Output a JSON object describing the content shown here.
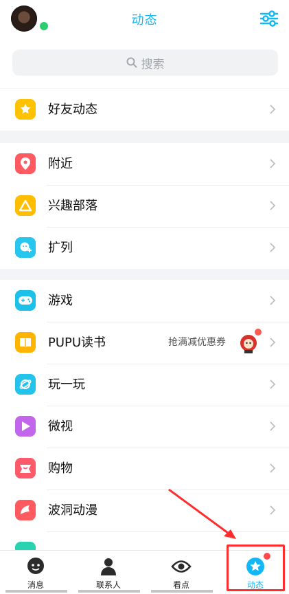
{
  "header": {
    "title": "动态",
    "settings_icon": "sliders-icon",
    "avatar_status_color": "#2ecc71"
  },
  "search": {
    "placeholder": "搜索"
  },
  "sections": [
    {
      "items": [
        {
          "label": "好友动态",
          "icon": "star-speech-icon",
          "color": "#ffc200"
        }
      ]
    },
    {
      "items": [
        {
          "label": "附近",
          "icon": "location-pin-icon",
          "color": "#ff5a5f"
        },
        {
          "label": "兴趣部落",
          "icon": "tent-icon",
          "color": "#ffbd00"
        },
        {
          "label": "扩列",
          "icon": "add-friend-icon",
          "color": "#27c6ee"
        }
      ]
    },
    {
      "items": [
        {
          "label": "游戏",
          "icon": "gamepad-icon",
          "color": "#1cc1ea"
        },
        {
          "label": "PUPU读书",
          "icon": "book-icon",
          "color": "#ffb400",
          "promo": "抢满减优惠券"
        },
        {
          "label": "玩一玩",
          "icon": "planet-icon",
          "color": "#23c3eb"
        },
        {
          "label": "微视",
          "icon": "play-icon",
          "color": "#c267ec"
        },
        {
          "label": "购物",
          "icon": "shopping-icon",
          "color": "#ff5a6a"
        },
        {
          "label": "波洞动漫",
          "icon": "comic-icon",
          "color": "#ff5a5f"
        }
      ]
    }
  ],
  "tabs": [
    {
      "label": "消息",
      "icon": "message-bubble-icon"
    },
    {
      "label": "联系人",
      "icon": "contacts-icon"
    },
    {
      "label": "看点",
      "icon": "eye-icon"
    },
    {
      "label": "动态",
      "icon": "star-icon",
      "active": true
    }
  ],
  "colors": {
    "accent": "#12b7f5",
    "badge": "#ff4a4a",
    "highlight": "#ff2d2d"
  }
}
